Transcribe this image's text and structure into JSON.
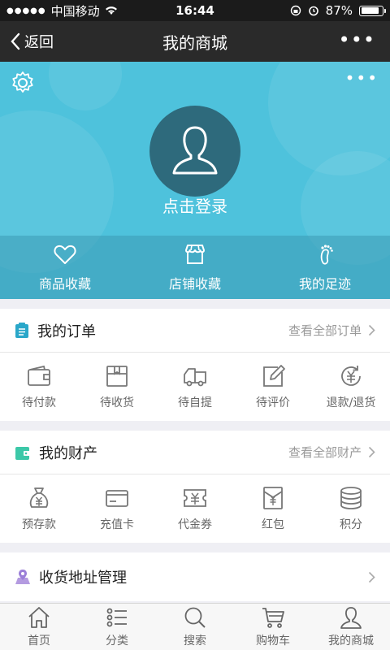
{
  "status_bar": {
    "carrier": "中国移动",
    "time": "16:44",
    "battery": "87%",
    "battery_level": 0.87
  },
  "nav": {
    "back_label": "返回",
    "title": "我的商城"
  },
  "profile": {
    "login_label": "点击登录",
    "favorites": [
      {
        "label": "商品收藏",
        "icon": "heart-icon"
      },
      {
        "label": "店铺收藏",
        "icon": "store-icon"
      },
      {
        "label": "我的足迹",
        "icon": "footprint-icon"
      }
    ]
  },
  "orders": {
    "title": "我的订单",
    "link": "查看全部订单",
    "items": [
      {
        "label": "待付款",
        "icon": "wallet-icon"
      },
      {
        "label": "待收货",
        "icon": "package-icon"
      },
      {
        "label": "待自提",
        "icon": "truck-icon"
      },
      {
        "label": "待评价",
        "icon": "edit-icon"
      },
      {
        "label": "退款/退货",
        "icon": "refund-icon"
      }
    ]
  },
  "assets": {
    "title": "我的财产",
    "link": "查看全部财产",
    "items": [
      {
        "label": "预存款",
        "icon": "money-bag-icon"
      },
      {
        "label": "充值卡",
        "icon": "card-icon"
      },
      {
        "label": "代金券",
        "icon": "voucher-icon"
      },
      {
        "label": "红包",
        "icon": "red-envelope-icon"
      },
      {
        "label": "积分",
        "icon": "coins-icon"
      }
    ]
  },
  "address": {
    "title": "收货地址管理"
  },
  "tabs": [
    {
      "label": "首页",
      "icon": "home-icon"
    },
    {
      "label": "分类",
      "icon": "category-icon"
    },
    {
      "label": "搜索",
      "icon": "search-icon"
    },
    {
      "label": "购物车",
      "icon": "cart-icon"
    },
    {
      "label": "我的商城",
      "icon": "user-icon"
    }
  ],
  "colors": {
    "header_bg": "#4ec2dc",
    "accent": "#2aa7c9",
    "nav_bg": "#2a2a2a",
    "text_muted": "#999999"
  }
}
